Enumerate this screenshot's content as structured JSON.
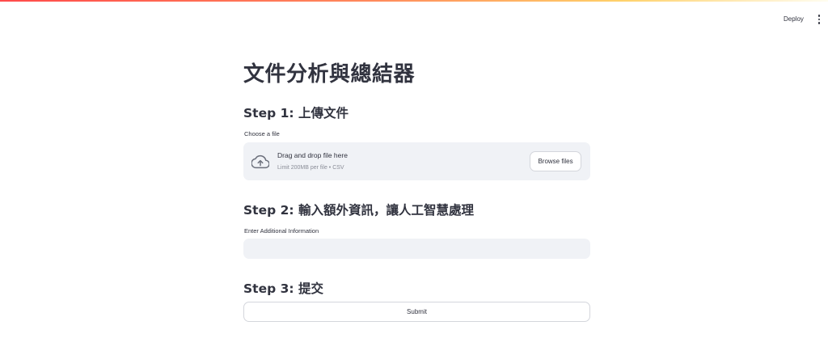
{
  "app": {
    "deploy_label": "Deploy",
    "menu_icon": "kebab-menu-icon",
    "accent_gradient": [
      "#ff4b4b",
      "#ffd16a"
    ]
  },
  "page": {
    "title": "文件分析與總結器"
  },
  "step1": {
    "heading": "Step 1: 上傳文件",
    "label": "Choose a file",
    "dropzone": {
      "icon": "cloud-upload-icon",
      "title": "Drag and drop file here",
      "subtitle": "Limit 200MB per file • CSV",
      "browse_label": "Browse files"
    }
  },
  "step2": {
    "heading": "Step 2: 輸入額外資訊，讓人工智慧處理",
    "label": "Enter Additional Information",
    "value": ""
  },
  "step3": {
    "heading": "Step 3: 提交",
    "submit_label": "Submit"
  },
  "colors": {
    "text": "#31333f",
    "widget_bg": "#f0f2f6",
    "border": "#d4d6dc",
    "muted": "#8a8d97"
  }
}
